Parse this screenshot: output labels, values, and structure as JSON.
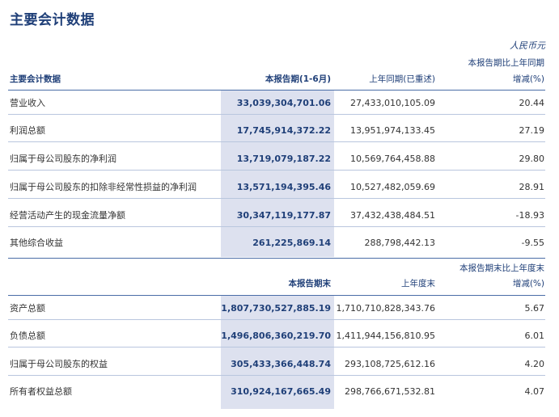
{
  "title": "主要会计数据",
  "unit": "人民币元",
  "section1": {
    "label_header": "主要会计数据",
    "current_header": "本报告期(1-6月)",
    "prior_header": "上年同期(已重述)",
    "change_header_line1": "本报告期比上年同期",
    "change_header_line2": "增减(%)",
    "rows": [
      {
        "label": "营业收入",
        "current": "33,039,304,701.06",
        "prior": "27,433,010,105.09",
        "change": "20.44"
      },
      {
        "label": "利润总额",
        "current": "17,745,914,372.22",
        "prior": "13,951,974,133.45",
        "change": "27.19"
      },
      {
        "label": "归属于母公司股东的净利润",
        "current": "13,719,079,187.22",
        "prior": "10,569,764,458.88",
        "change": "29.80"
      },
      {
        "label": "归属于母公司股东的扣除非经常性损益的净利润",
        "current": "13,571,194,395.46",
        "prior": "10,527,482,059.69",
        "change": "28.91"
      },
      {
        "label": "经营活动产生的现金流量净额",
        "current": "30,347,119,177.87",
        "prior": "37,432,438,484.51",
        "change": "-18.93"
      },
      {
        "label": "其他综合收益",
        "current": "261,225,869.14",
        "prior": "288,798,442.13",
        "change": "-9.55"
      }
    ]
  },
  "section2": {
    "current_header": "本报告期末",
    "prior_header": "上年度末",
    "change_header_line1": "本报告期末比上年度末",
    "change_header_line2": "增减(%)",
    "rows": [
      {
        "label": "资产总额",
        "current": "1,807,730,527,885.19",
        "prior": "1,710,710,828,343.76",
        "change": "5.67"
      },
      {
        "label": "负债总额",
        "current": "1,496,806,360,219.70",
        "prior": "1,411,944,156,810.95",
        "change": "6.01"
      },
      {
        "label": "归属于母公司股东的权益",
        "current": "305,433,366,448.74",
        "prior": "293,108,725,612.16",
        "change": "4.20"
      },
      {
        "label": "所有者权益总额",
        "current": "310,924,167,665.49",
        "prior": "298,766,671,532.81",
        "change": "4.07"
      }
    ]
  }
}
